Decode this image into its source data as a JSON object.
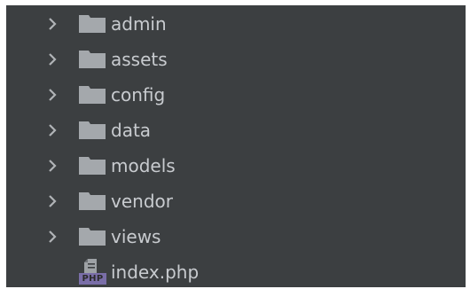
{
  "tree": {
    "folders": [
      {
        "label": "admin",
        "icon": "folder-icon",
        "expand_icon": "chevron-right-icon"
      },
      {
        "label": "assets",
        "icon": "folder-icon",
        "expand_icon": "chevron-right-icon"
      },
      {
        "label": "config",
        "icon": "folder-icon",
        "expand_icon": "chevron-right-icon"
      },
      {
        "label": "data",
        "icon": "folder-icon",
        "expand_icon": "chevron-right-icon"
      },
      {
        "label": "models",
        "icon": "folder-icon",
        "expand_icon": "chevron-right-icon"
      },
      {
        "label": "vendor",
        "icon": "folder-icon",
        "expand_icon": "chevron-right-icon"
      },
      {
        "label": "views",
        "icon": "folder-icon",
        "expand_icon": "chevron-right-icon"
      }
    ],
    "files": [
      {
        "label": "index.php",
        "icon": "php-file-icon",
        "badge": "PHP"
      }
    ]
  },
  "colors": {
    "background": "#3c3f41",
    "text": "#c8cbcf",
    "folder": "#a4a8ac",
    "chevron": "#b0b3b6",
    "php_badge": "#7a6ea8"
  }
}
